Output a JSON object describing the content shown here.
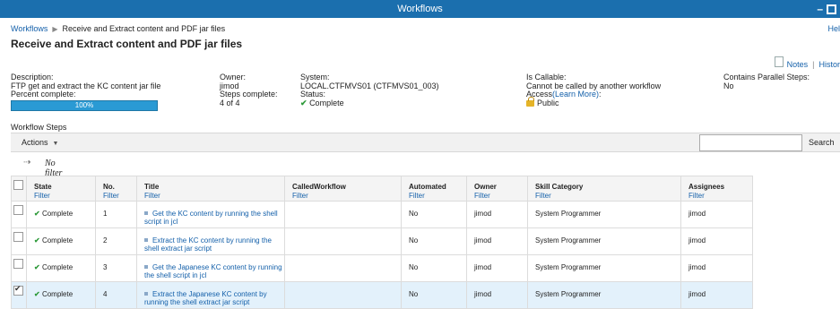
{
  "window": {
    "title": "Workflows"
  },
  "breadcrumb": {
    "root": "Workflows",
    "current": "Receive and Extract content and PDF jar files"
  },
  "help_link": "Hel",
  "page_title": "Receive and Extract content and PDF jar files",
  "links": {
    "notes": "Notes",
    "history": "Histor"
  },
  "info": {
    "description_label": "Description:",
    "description_value": "FTP get and extract the KC content jar file",
    "percent_label": "Percent complete:",
    "percent_value": "100%",
    "percent_fraction": 1.0,
    "owner_label": "Owner:",
    "owner_value": "jimod",
    "steps_label": "Steps complete:",
    "steps_value": "4 of 4",
    "system_label": "System:",
    "system_value": "LOCAL.CTFMVS01 (CTFMVS01_003)",
    "status_label": "Status:",
    "status_value": "Complete",
    "callable_label": "Is Callable:",
    "callable_value": "Cannot be called by another workflow",
    "access_label": "Access",
    "access_link": "(Learn More)",
    "access_colon": ":",
    "access_value": "Public",
    "parallel_label": "Contains Parallel Steps:",
    "parallel_value": "No"
  },
  "steps_section_label": "Workflow Steps",
  "toolbar": {
    "actions_label": "Actions",
    "search_button": "Search",
    "search_value": ""
  },
  "filter_status": "No filter applied",
  "table": {
    "filter_label": "Filter",
    "columns": [
      "State",
      "No.",
      "Title",
      "CalledWorkflow",
      "Automated",
      "Owner",
      "Skill Category",
      "Assignees"
    ],
    "rows": [
      {
        "checked": false,
        "state": "Complete",
        "no": "1",
        "title": "Get the KC content by running the shell script in jcl",
        "called": "",
        "automated": "No",
        "owner": "jimod",
        "skill": "System Programmer",
        "assignees": "jimod"
      },
      {
        "checked": false,
        "state": "Complete",
        "no": "2",
        "title": "Extract the KC content by running the shell extract jar script",
        "called": "",
        "automated": "No",
        "owner": "jimod",
        "skill": "System Programmer",
        "assignees": "jimod"
      },
      {
        "checked": false,
        "state": "Complete",
        "no": "3",
        "title": "Get the Japanese KC content by running the shell script in jcl",
        "called": "",
        "automated": "No",
        "owner": "jimod",
        "skill": "System Programmer",
        "assignees": "jimod"
      },
      {
        "checked": true,
        "state": "Complete",
        "no": "4",
        "title": "Extract the Japanese KC content by running the shell extract jar script",
        "called": "",
        "automated": "No",
        "owner": "jimod",
        "skill": "System Programmer",
        "assignees": "jimod"
      }
    ]
  },
  "icons": {
    "check": "checkmark-icon",
    "lock": "unlocked-padlock-icon",
    "filter": "filter-icon",
    "notes": "note-icon"
  },
  "colors": {
    "titlebar": "#1b6fae",
    "link": "#1460aa",
    "progress": "#2a9ad4",
    "complete": "#2e9a3a",
    "selected_row": "#e3f1fb"
  }
}
